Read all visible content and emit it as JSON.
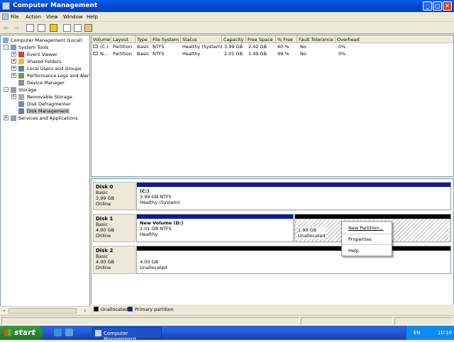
{
  "window": {
    "title": "Computer Management"
  },
  "menu": {
    "items": [
      "File",
      "Action",
      "View",
      "Window",
      "Help"
    ]
  },
  "tree": {
    "root": "Computer Management (Local)",
    "system_tools": "System Tools",
    "event_viewer": "Event Viewer",
    "shared_folders": "Shared Folders",
    "local_users": "Local Users and Groups",
    "perf_logs": "Performance Logs and Alerts",
    "device_manager": "Device Manager",
    "storage": "Storage",
    "removable_storage": "Removable Storage",
    "disk_defrag": "Disk Defragmenter",
    "disk_management": "Disk Management",
    "services": "Services and Applications"
  },
  "volumes": {
    "columns": [
      "Volume",
      "Layout",
      "Type",
      "File System",
      "Status",
      "Capacity",
      "Free Space",
      "% Free",
      "Fault Tolerance",
      "Overhead"
    ],
    "rows": [
      [
        "(C:)",
        "Partition",
        "Basic",
        "NTFS",
        "Healthy (System)",
        "3.99 GB",
        "2.42 GB",
        "60 %",
        "No",
        "0%"
      ],
      [
        "N...",
        "Partition",
        "Basic",
        "NTFS",
        "Healthy",
        "2.01 GB",
        "1.99 GB",
        "99 %",
        "No",
        "0%"
      ]
    ]
  },
  "disks": [
    {
      "name": "Disk 0",
      "type": "Basic",
      "size": "3.99 GB",
      "state": "Online",
      "partitions": [
        {
          "label": "(C:)",
          "size_fs": "3.99 GB NTFS",
          "status": "Healthy (System)"
        }
      ]
    },
    {
      "name": "Disk 1",
      "type": "Basic",
      "size": "4.00 GB",
      "state": "Online",
      "partitions": [
        {
          "label": "New Volume  (D:)",
          "size_fs": "2.01 GB NTFS",
          "status": "Healthy"
        },
        {
          "label": "",
          "size_fs": "1.99 GB",
          "status": "Unallocated"
        }
      ]
    },
    {
      "name": "Disk 2",
      "type": "Basic",
      "size": "4.00 GB",
      "state": "Online",
      "partitions": [
        {
          "label": "",
          "size_fs": "4.00 GB",
          "status": "Unallocated"
        }
      ]
    }
  ],
  "legend": {
    "unallocated": "Unallocated",
    "primary": "Primary partition"
  },
  "context_menu": {
    "items": [
      "New Partition...",
      "Properties",
      "Help"
    ]
  },
  "taskbar": {
    "start": "start",
    "task": "Computer Management",
    "lang": "EN",
    "clock": "10:18"
  },
  "colors": {
    "primary": "#0a1a9c",
    "unallocated": "#000000",
    "accent": "#0a5ee8"
  }
}
